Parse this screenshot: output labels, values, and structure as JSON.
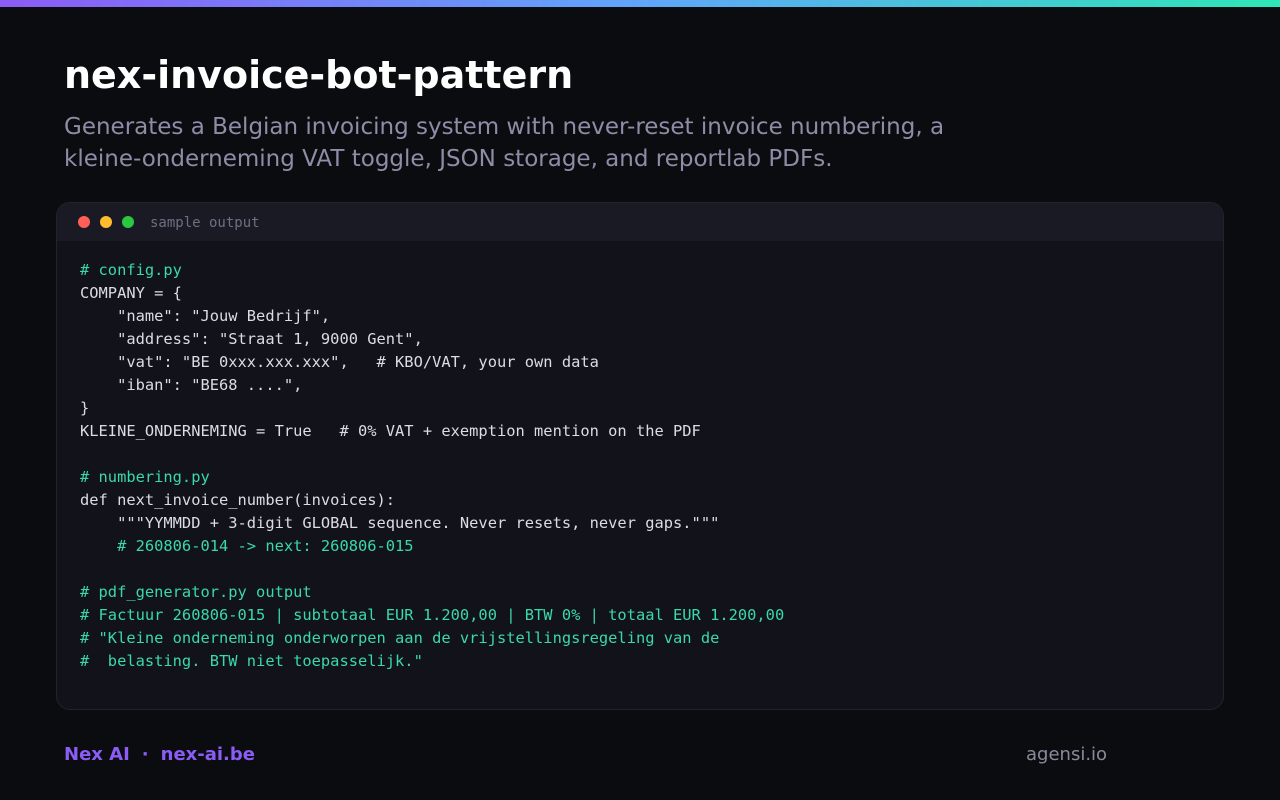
{
  "colors": {
    "background": "#0b0c10",
    "gradient_start": "#8b5cf6",
    "gradient_mid": "#60a5fa",
    "gradient_end": "#2ee6b6",
    "brand_purple": "#8b5cf6",
    "code_comment": "#3ad9a8",
    "code_text": "#dcdce4",
    "dot_red": "#ff5f57",
    "dot_yellow": "#febc2e",
    "dot_green": "#28c840"
  },
  "header": {
    "title": "nex-invoice-bot-pattern",
    "subtitle": "Generates a Belgian invoicing system with never-reset invoice numbering, a kleine-onderneming VAT toggle, JSON storage, and reportlab PDFs."
  },
  "window": {
    "label": "sample output",
    "dots": [
      "close-dot",
      "minimize-dot",
      "maximize-dot"
    ]
  },
  "code_lines": [
    {
      "text": "# config.py",
      "comment": true
    },
    {
      "text": "COMPANY = {",
      "comment": false
    },
    {
      "text": "    \"name\": \"Jouw Bedrijf\",",
      "comment": false
    },
    {
      "text": "    \"address\": \"Straat 1, 9000 Gent\",",
      "comment": false
    },
    {
      "text": "    \"vat\": \"BE 0xxx.xxx.xxx\",   # KBO/VAT, your own data",
      "comment": false
    },
    {
      "text": "    \"iban\": \"BE68 ....\",",
      "comment": false
    },
    {
      "text": "}",
      "comment": false
    },
    {
      "text": "KLEINE_ONDERNEMING = True   # 0% VAT + exemption mention on the PDF",
      "comment": false
    },
    {
      "text": "",
      "comment": false
    },
    {
      "text": "# numbering.py",
      "comment": true
    },
    {
      "text": "def next_invoice_number(invoices):",
      "comment": false
    },
    {
      "text": "    \"\"\"YYMMDD + 3-digit GLOBAL sequence. Never resets, never gaps.\"\"\"",
      "comment": false
    },
    {
      "text": "    # 260806-014 -> next: 260806-015",
      "comment": true
    },
    {
      "text": "",
      "comment": false
    },
    {
      "text": "# pdf_generator.py output",
      "comment": true
    },
    {
      "text": "# Factuur 260806-015 | subtotaal EUR 1.200,00 | BTW 0% | totaal EUR 1.200,00",
      "comment": true
    },
    {
      "text": "# \"Kleine onderneming onderworpen aan de vrijstellingsregeling van de",
      "comment": true
    },
    {
      "text": "#  belasting. BTW niet toepasselijk.\"",
      "comment": true
    }
  ],
  "footer": {
    "brand": "Nex AI",
    "separator": "·",
    "site": "nex-ai.be",
    "credit": "agensi.io"
  }
}
